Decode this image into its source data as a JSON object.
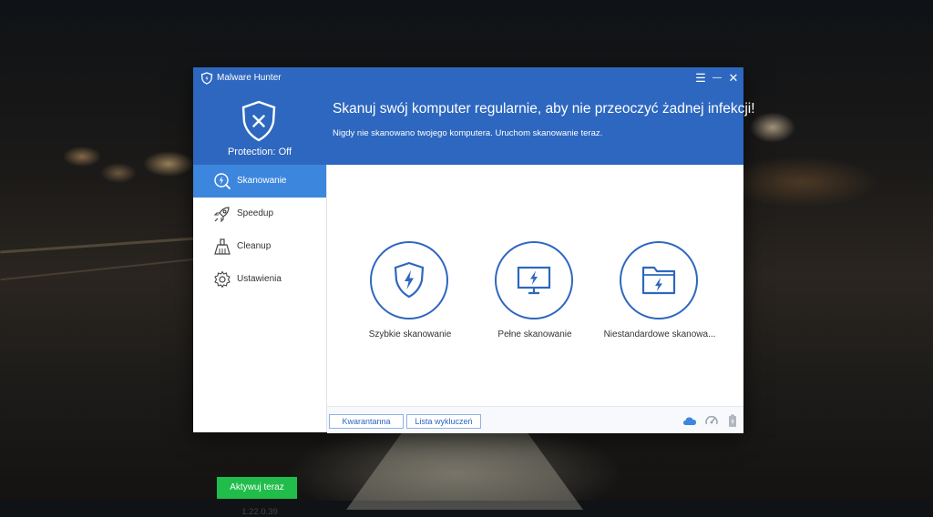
{
  "app": {
    "title": "Malware Hunter"
  },
  "window_controls": {
    "menu": "☰",
    "minimize": "—",
    "close": "✕"
  },
  "status": {
    "protection": "Protection: Off"
  },
  "banner": {
    "headline": "Skanuj swój komputer regularnie, aby nie przeoczyć żadnej infekcji!",
    "subline": "Nigdy nie skanowano twojego komputera. Uruchom skanowanie teraz."
  },
  "sidebar": {
    "items": [
      {
        "label": "Skanowanie",
        "icon": "scan-icon",
        "active": true
      },
      {
        "label": "Speedup",
        "icon": "rocket-icon",
        "active": false
      },
      {
        "label": "Cleanup",
        "icon": "broom-icon",
        "active": false
      },
      {
        "label": "Ustawienia",
        "icon": "gear-icon",
        "active": false
      }
    ],
    "activate_label": "Aktywuj teraz",
    "version": "1.22.0.39"
  },
  "scan_options": [
    {
      "label": "Szybkie skanowanie",
      "icon": "shield-bolt-icon"
    },
    {
      "label": "Pełne skanowanie",
      "icon": "monitor-bolt-icon"
    },
    {
      "label": "Niestandardowe skanowa...",
      "icon": "folder-bolt-icon"
    }
  ],
  "footer": {
    "quarantine_label": "Kwarantanna",
    "exclusions_label": "Lista wykluczeń",
    "icons": [
      "cloud-icon",
      "speed-meter-icon",
      "battery-icon"
    ]
  },
  "colors": {
    "brand_blue": "#2d67bf",
    "active_blue": "#3d86dd",
    "activate_green": "#20bd4a"
  }
}
